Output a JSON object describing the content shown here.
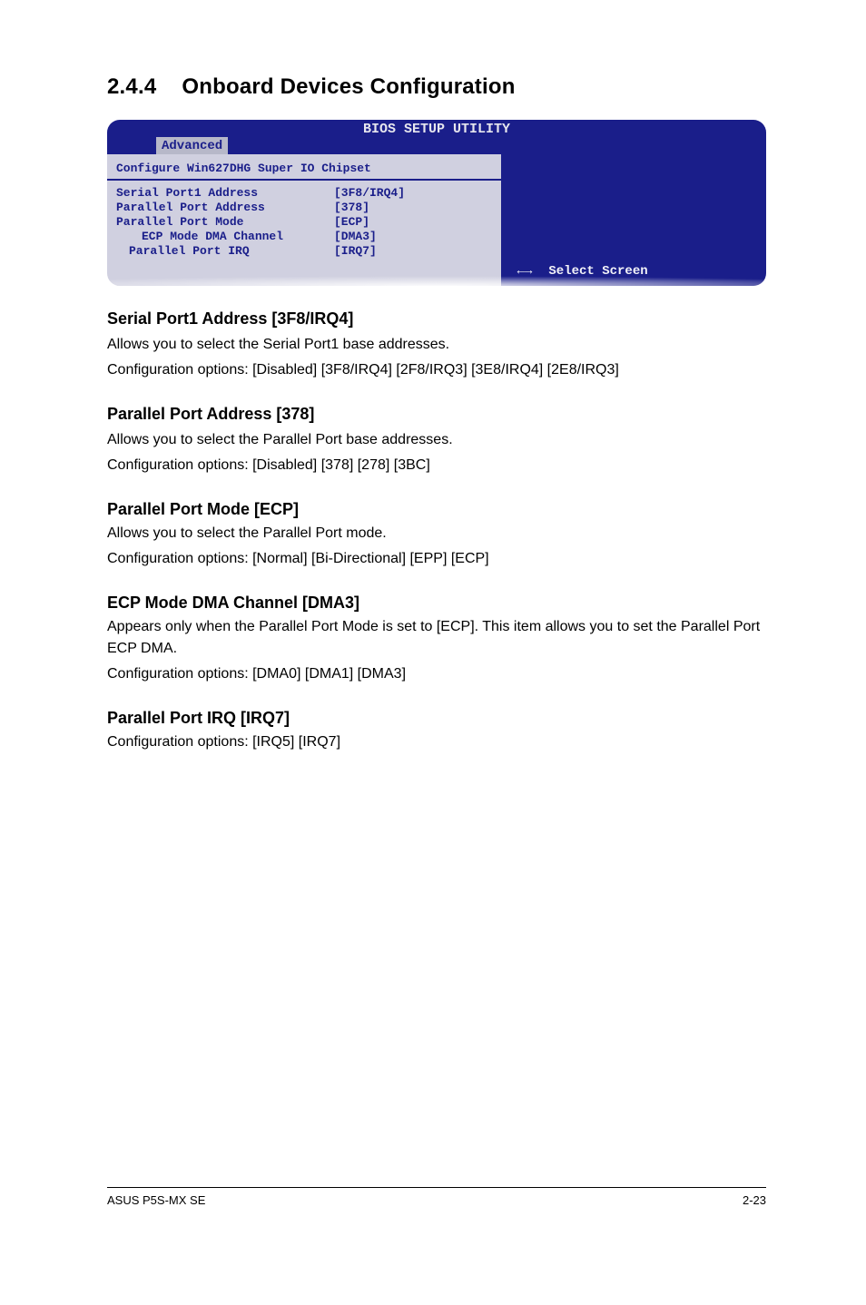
{
  "section": {
    "number": "2.4.4",
    "title": "Onboard Devices Configuration"
  },
  "bios": {
    "utility_title": "BIOS SETUP UTILITY",
    "tab_label": "Advanced",
    "panel_title": "Configure Win627DHG Super IO Chipset",
    "rows": [
      {
        "label": "Serial Port1 Address",
        "value": "[3F8/IRQ4]",
        "indent": 0
      },
      {
        "label": "Parallel Port Address",
        "value": "[378]",
        "indent": 0
      },
      {
        "label": "Parallel Port Mode",
        "value": "[ECP]",
        "indent": 0
      },
      {
        "label": "ECP Mode DMA Channel",
        "value": "[DMA3]",
        "indent": 1
      },
      {
        "label": "Parallel Port IRQ",
        "value": "[IRQ7]",
        "indent": 1
      }
    ],
    "select_screen": "Select Screen"
  },
  "content": {
    "s1_h": "Serial Port1 Address [3F8/IRQ4]",
    "s1_p1": "Allows you to select the Serial Port1 base addresses.",
    "s1_p2": "Configuration options: [Disabled] [3F8/IRQ4] [2F8/IRQ3] [3E8/IRQ4] [2E8/IRQ3]",
    "s2_h": "Parallel Port Address [378]",
    "s2_p1": "Allows you to select the Parallel Port base addresses.",
    "s2_p2": "Configuration options: [Disabled] [378] [278] [3BC]",
    "s3_h": "Parallel Port Mode [ECP]",
    "s3_p1": "Allows you to select the Parallel Port  mode.",
    "s3_p2": "Configuration options: [Normal] [Bi-Directional] [EPP] [ECP]",
    "s4_h": "ECP Mode DMA Channel [DMA3]",
    "s4_p1": "Appears only when the Parallel Port Mode is set to [ECP]. This item allows you to set the Parallel Port ECP DMA.",
    "s4_p2": "Configuration options: [DMA0] [DMA1] [DMA3]",
    "s5_h": "Parallel Port IRQ [IRQ7]",
    "s5_p1": "Configuration options: [IRQ5] [IRQ7]"
  },
  "footer": {
    "left": "ASUS P5S-MX SE",
    "right": "2-23"
  },
  "icons": {
    "arrows": "←→"
  }
}
